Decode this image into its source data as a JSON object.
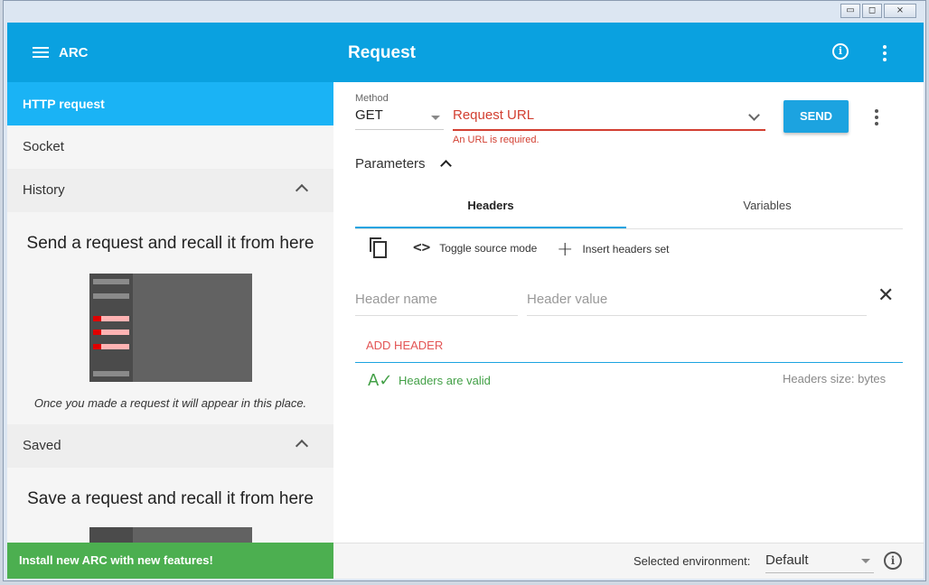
{
  "window": {
    "controls": [
      "▭",
      "◻",
      "⨯"
    ]
  },
  "appbar": {
    "menu_icon": "hamburger-icon",
    "app_name": "ARC",
    "title": "Request",
    "info_icon": "info-icon",
    "more_icon": "more-vert-icon"
  },
  "sidebar": {
    "items": [
      {
        "label": "HTTP request",
        "active": true
      },
      {
        "label": "Socket"
      },
      {
        "label": "History",
        "expanded": true
      },
      {
        "label": "Saved",
        "expanded": true
      }
    ],
    "history": {
      "empty_title": "Send a request and recall it from here",
      "empty_desc": "Once you made a request it will appear in this place."
    },
    "saved": {
      "empty_title": "Save a request and recall it from here"
    },
    "install_banner": "Install new ARC with new features!"
  },
  "request": {
    "method_label": "Method",
    "method_value": "GET",
    "url_placeholder": "Request URL",
    "url_error": "An URL is required.",
    "send_label": "SEND",
    "parameters_label": "Parameters",
    "tabs": [
      {
        "label": "Headers",
        "active": true
      },
      {
        "label": "Variables"
      }
    ],
    "toolbar": {
      "toggle_source": "Toggle source mode",
      "insert_set": "Insert headers set"
    },
    "header_name_placeholder": "Header name",
    "header_value_placeholder": "Header value",
    "add_header_label": "ADD HEADER",
    "valid_message": "Headers are valid",
    "headers_size": "Headers size: bytes"
  },
  "footer": {
    "env_label": "Selected environment:",
    "env_value": "Default"
  },
  "colors": {
    "primary": "#0aa1e0",
    "active_nav": "#1ab3f5",
    "error": "#d23f31",
    "success": "#43a047",
    "banner": "#4caf50"
  }
}
